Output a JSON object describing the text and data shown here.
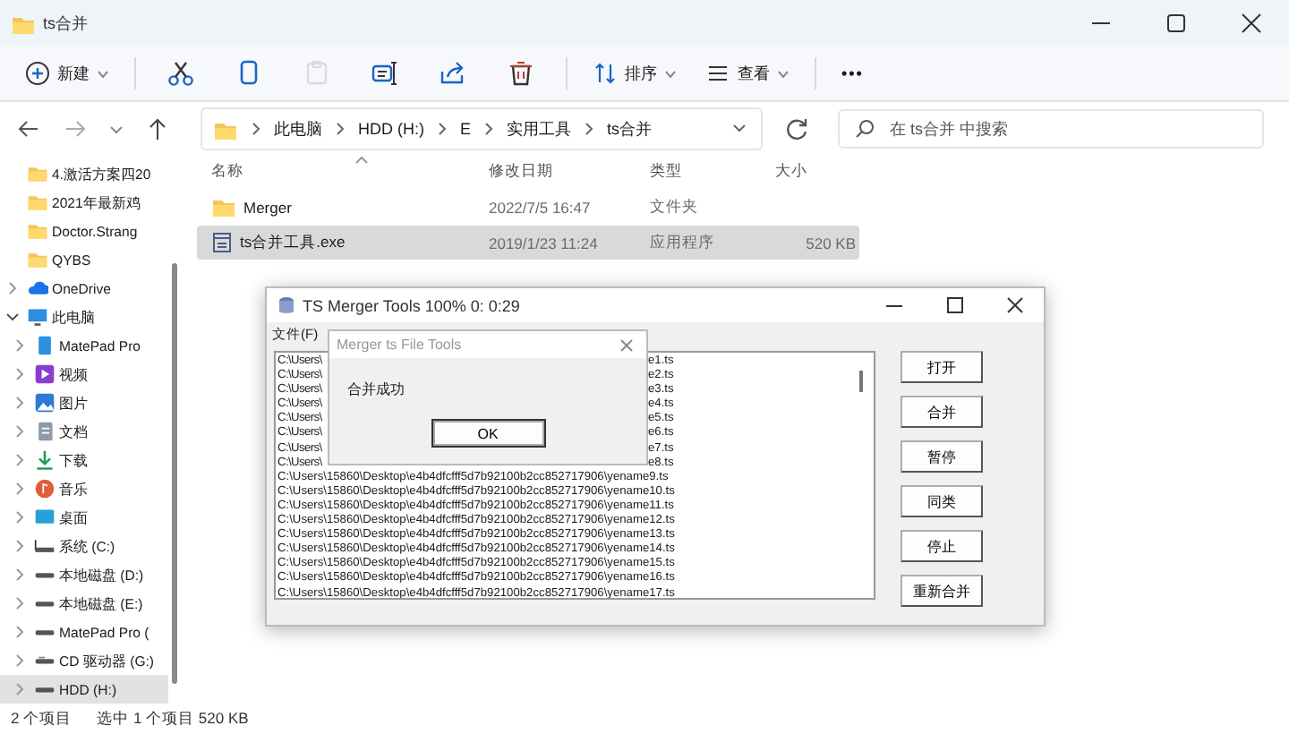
{
  "window": {
    "title": "ts合并"
  },
  "toolbar": [
    {
      "kind": "new",
      "label": "新建",
      "disabled": false
    },
    {
      "kind": "cut",
      "disabled": false
    },
    {
      "kind": "copy",
      "disabled": false
    },
    {
      "kind": "paste",
      "disabled": true
    },
    {
      "kind": "rename",
      "disabled": false
    },
    {
      "kind": "share",
      "disabled": false
    },
    {
      "kind": "delete",
      "disabled": false
    },
    {
      "kind": "sort",
      "label": "排序",
      "disabled": false
    },
    {
      "kind": "view",
      "label": "查看",
      "disabled": false
    },
    {
      "kind": "more",
      "label": "•••",
      "disabled": false
    }
  ],
  "address": {
    "crumbs": [
      "此电脑",
      "HDD (H:)",
      "E",
      "实用工具",
      "ts合并"
    ]
  },
  "search": {
    "placeholder": "在 ts合并 中搜索"
  },
  "sidebar": {
    "items": [
      {
        "kind": "folder",
        "label": "4.激活方案四20",
        "selected": false
      },
      {
        "kind": "folder",
        "label": "2021年最新鸡",
        "selected": false
      },
      {
        "kind": "folder",
        "label": "Doctor.Strang",
        "selected": false
      },
      {
        "kind": "folder",
        "label": "QYBS",
        "selected": false
      },
      {
        "kind": "cloud",
        "label": "OneDrive",
        "expanded": false,
        "selected": false
      },
      {
        "kind": "computer",
        "label": "此电脑",
        "expanded": true,
        "selected": false,
        "children": [
          {
            "kind": "tablet",
            "label": "MatePad Pro",
            "expanded": false,
            "selected": false
          },
          {
            "kind": "video",
            "label": "视频",
            "expanded": false,
            "selected": false
          },
          {
            "kind": "pictures",
            "label": "图片",
            "expanded": false,
            "selected": false
          },
          {
            "kind": "documents",
            "label": "文档",
            "expanded": false,
            "selected": false
          },
          {
            "kind": "downloads",
            "label": "下载",
            "expanded": false,
            "selected": false
          },
          {
            "kind": "music",
            "label": "音乐",
            "expanded": false,
            "selected": false
          },
          {
            "kind": "desktop",
            "label": "桌面",
            "expanded": false,
            "selected": false
          },
          {
            "kind": "system-drive",
            "label": "系统 (C:)",
            "expanded": false,
            "selected": false
          },
          {
            "kind": "drive",
            "label": "本地磁盘 (D:)",
            "expanded": false,
            "selected": false
          },
          {
            "kind": "drive",
            "label": "本地磁盘 (E:)",
            "expanded": false,
            "selected": false
          },
          {
            "kind": "drive",
            "label": "MatePad Pro (",
            "expanded": false,
            "selected": false
          },
          {
            "kind": "cd-drive",
            "label": "CD 驱动器 (G:)",
            "expanded": false,
            "selected": false
          },
          {
            "kind": "drive",
            "label": "HDD (H:)",
            "expanded": false,
            "selected": true
          }
        ]
      }
    ]
  },
  "table": {
    "columns": [
      "名称",
      "修改日期",
      "类型",
      "大小"
    ],
    "rows": [
      {
        "kind": "folder",
        "cells": [
          "Merger",
          "2022/7/5 16:47",
          "文件夹",
          ""
        ],
        "selected": false
      },
      {
        "kind": "app",
        "cells": [
          "ts合并工具.exe",
          "2019/1/23 11:24",
          "应用程序",
          "520 KB"
        ],
        "selected": true
      }
    ]
  },
  "status_bar": {
    "count": "2 个项目",
    "selection": "选中 1 个项目  520 KB"
  },
  "merger_window": {
    "title": "TS Merger Tools 100%  0: 0:29",
    "menu": [
      "文件(F)"
    ],
    "files": [
      {
        "kind": "covered",
        "start": "C:\\Users\\",
        "end": "e1.ts"
      },
      {
        "kind": "covered",
        "start": "C:\\Users\\",
        "end": "e2.ts"
      },
      {
        "kind": "covered",
        "start": "C:\\Users\\",
        "end": "e3.ts"
      },
      {
        "kind": "covered",
        "start": "C:\\Users\\",
        "end": "e4.ts"
      },
      {
        "kind": "covered",
        "start": "C:\\Users\\",
        "end": "e5.ts"
      },
      {
        "kind": "covered",
        "start": "C:\\Users\\",
        "end": "e6.ts"
      },
      {
        "kind": "covered",
        "start": "C:\\Users\\",
        "end": "e7.ts"
      },
      {
        "kind": "covered",
        "start": "C:\\Users\\",
        "end": "e8.ts"
      },
      {
        "kind": "full",
        "text": "C:\\Users\\15860\\Desktop\\e4b4dfcfff5d7b92100b2cc852717906\\yename9.ts"
      },
      {
        "kind": "full",
        "text": "C:\\Users\\15860\\Desktop\\e4b4dfcfff5d7b92100b2cc852717906\\yename10.ts"
      },
      {
        "kind": "full",
        "text": "C:\\Users\\15860\\Desktop\\e4b4dfcfff5d7b92100b2cc852717906\\yename11.ts"
      },
      {
        "kind": "full",
        "text": "C:\\Users\\15860\\Desktop\\e4b4dfcfff5d7b92100b2cc852717906\\yename12.ts"
      },
      {
        "kind": "full",
        "text": "C:\\Users\\15860\\Desktop\\e4b4dfcfff5d7b92100b2cc852717906\\yename13.ts"
      },
      {
        "kind": "full",
        "text": "C:\\Users\\15860\\Desktop\\e4b4dfcfff5d7b92100b2cc852717906\\yename14.ts"
      },
      {
        "kind": "full",
        "text": "C:\\Users\\15860\\Desktop\\e4b4dfcfff5d7b92100b2cc852717906\\yename15.ts"
      },
      {
        "kind": "full",
        "text": "C:\\Users\\15860\\Desktop\\e4b4dfcfff5d7b92100b2cc852717906\\yename16.ts"
      },
      {
        "kind": "full",
        "text": "C:\\Users\\15860\\Desktop\\e4b4dfcfff5d7b92100b2cc852717906\\yename17.ts"
      }
    ],
    "buttons": [
      "打开",
      "合并",
      "暂停",
      "同类",
      "停止",
      "重新合并"
    ]
  },
  "message_box": {
    "title": "Merger ts File Tools",
    "message": "合并成功",
    "button": "OK"
  }
}
